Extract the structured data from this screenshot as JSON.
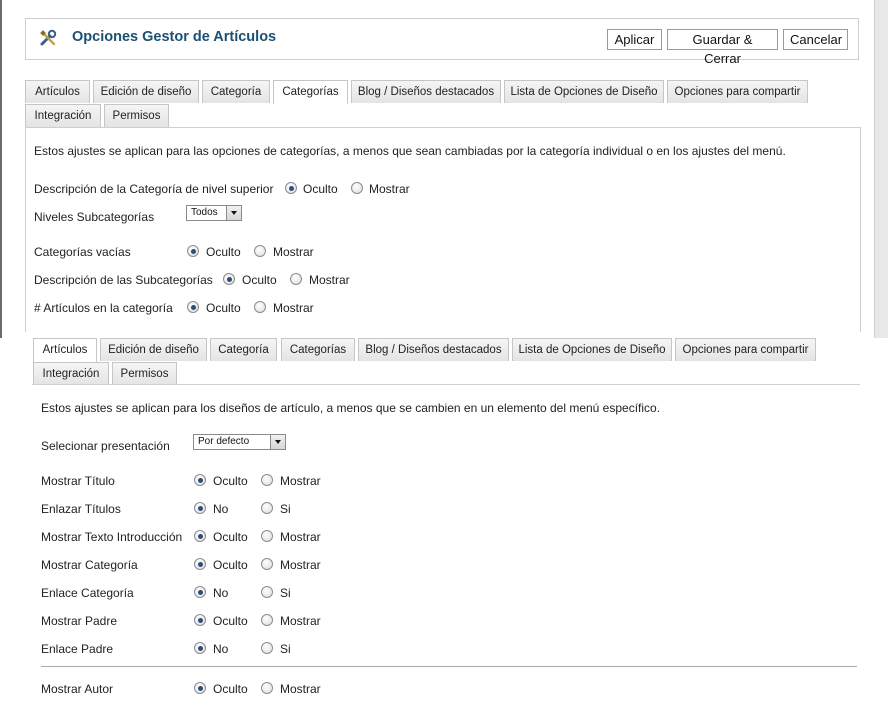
{
  "header": {
    "title": "Opciones Gestor de Artículos",
    "icon": "tools-icon",
    "buttons": {
      "apply": "Aplicar",
      "save_close": "Guardar & Cerrar",
      "cancel": "Cancelar"
    }
  },
  "top_panel": {
    "tabs": [
      "Artículos",
      "Edición de diseño",
      "Categoría",
      "Categorías",
      "Blog / Diseños destacados",
      "Lista de Opciones de Diseño",
      "Opciones para compartir",
      "Integración",
      "Permisos"
    ],
    "active_tab": "Categorías",
    "intro": "Estos ajustes se aplican para las opciones de categorías, a menos que sean cambiadas por la categoría individual o en los ajustes del menú.",
    "fields": [
      {
        "label": "Descripción de la Categoría de nivel superior",
        "options": [
          "Oculto",
          "Mostrar"
        ],
        "selected": "Oculto"
      },
      {
        "label": "Niveles Subcategorías",
        "select_value": "Todos"
      },
      {
        "label": "Categorías vacías",
        "options": [
          "Oculto",
          "Mostrar"
        ],
        "selected": "Oculto"
      },
      {
        "label": "Descripción de las Subcategorías",
        "options": [
          "Oculto",
          "Mostrar"
        ],
        "selected": "Oculto"
      },
      {
        "label": "# Artículos en la categoría",
        "options": [
          "Oculto",
          "Mostrar"
        ],
        "selected": "Oculto"
      }
    ]
  },
  "bottom_panel": {
    "tabs": [
      "Artículos",
      "Edición de diseño",
      "Categoría",
      "Categorías",
      "Blog / Diseños destacados",
      "Lista de Opciones de Diseño",
      "Opciones para compartir",
      "Integración",
      "Permisos"
    ],
    "active_tab": "Artículos",
    "intro": "Estos ajustes se aplican para los diseños de artículo, a menos que se cambien en un elemento del menú específico.",
    "select_layout": {
      "label": "Selecionar presentación",
      "value": "Por defecto"
    },
    "fields": [
      {
        "label": "Mostrar Título",
        "options": [
          "Oculto",
          "Mostrar"
        ],
        "selected": "Oculto"
      },
      {
        "label": "Enlazar Títulos",
        "options": [
          "No",
          "Si"
        ],
        "selected": "No"
      },
      {
        "label": "Mostrar Texto Introducción",
        "options": [
          "Oculto",
          "Mostrar"
        ],
        "selected": "Oculto"
      },
      {
        "label": "Mostrar Categoría",
        "options": [
          "Oculto",
          "Mostrar"
        ],
        "selected": "Oculto"
      },
      {
        "label": "Enlace Categoría",
        "options": [
          "No",
          "Si"
        ],
        "selected": "No"
      },
      {
        "label": "Mostrar Padre",
        "options": [
          "Oculto",
          "Mostrar"
        ],
        "selected": "Oculto"
      },
      {
        "label": "Enlace Padre",
        "options": [
          "No",
          "Si"
        ],
        "selected": "No"
      },
      {
        "label": "Mostrar Autor",
        "options": [
          "Oculto",
          "Mostrar"
        ],
        "selected": "Oculto"
      }
    ]
  },
  "colors": {
    "title": "#1d4f73",
    "radio_dot": "#2a4f7e",
    "border": "#cfcfcf"
  }
}
